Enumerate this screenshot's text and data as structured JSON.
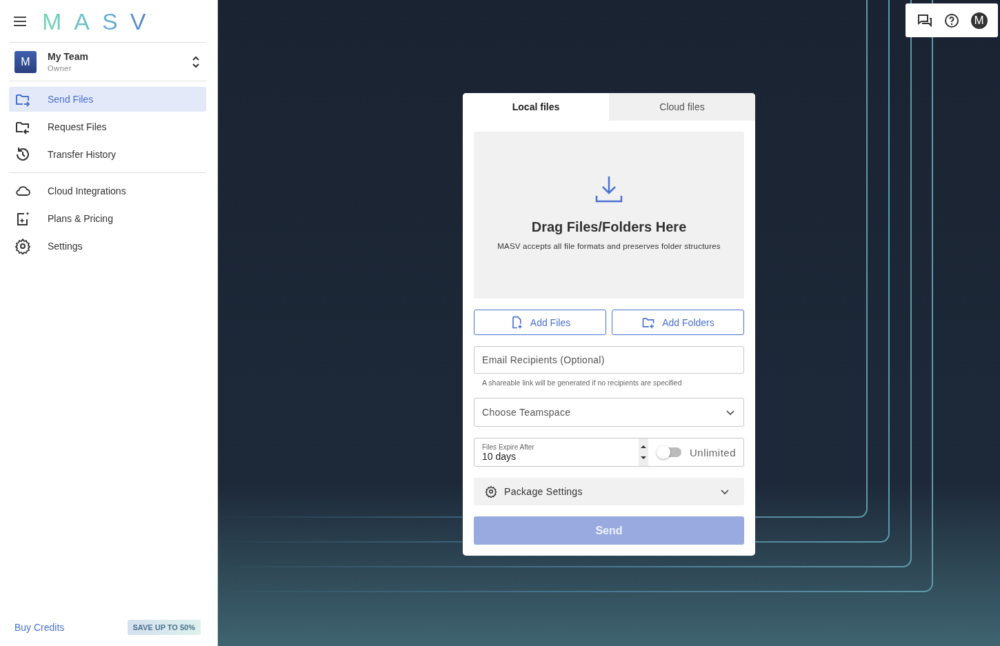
{
  "logo": "MASV",
  "team": {
    "avatar": "M",
    "name": "My Team",
    "role": "Owner"
  },
  "nav_groups": [
    [
      {
        "label": "Send Files",
        "selected": true
      },
      {
        "label": "Request Files",
        "selected": false
      },
      {
        "label": "Transfer History",
        "selected": false
      }
    ],
    [
      {
        "label": "Cloud Integrations",
        "selected": false
      },
      {
        "label": "Plans & Pricing",
        "selected": false
      },
      {
        "label": "Settings",
        "selected": false
      }
    ]
  ],
  "footer": {
    "link": "Buy Credits",
    "badge": "SAVE UP TO 50%"
  },
  "toolbar": {
    "avatar": "M"
  },
  "card": {
    "tabs": [
      {
        "label": "Local files",
        "selected": true
      },
      {
        "label": "Cloud files",
        "selected": false
      }
    ],
    "dropzone": {
      "title": "Drag Files/Folders Here",
      "subtitle": "MASV accepts all file formats and preserves folder structures"
    },
    "buttons": [
      {
        "kind": "file",
        "label": "Add Files"
      },
      {
        "kind": "folder",
        "label": "Add Folders"
      }
    ],
    "email": {
      "placeholder": "Email Recipients (Optional)",
      "hint": "A shareable link will be generated if no recipients are specified"
    },
    "teamspace": {
      "placeholder": "Choose Teamspace"
    },
    "expiry": {
      "label": "Files Expire After",
      "value": "10 days",
      "unlimited_label": "Unlimited",
      "unlimited": false
    },
    "package_settings": {
      "label": "Package Settings",
      "expanded": false
    },
    "send": {
      "label": "Send",
      "disabled": true
    }
  }
}
